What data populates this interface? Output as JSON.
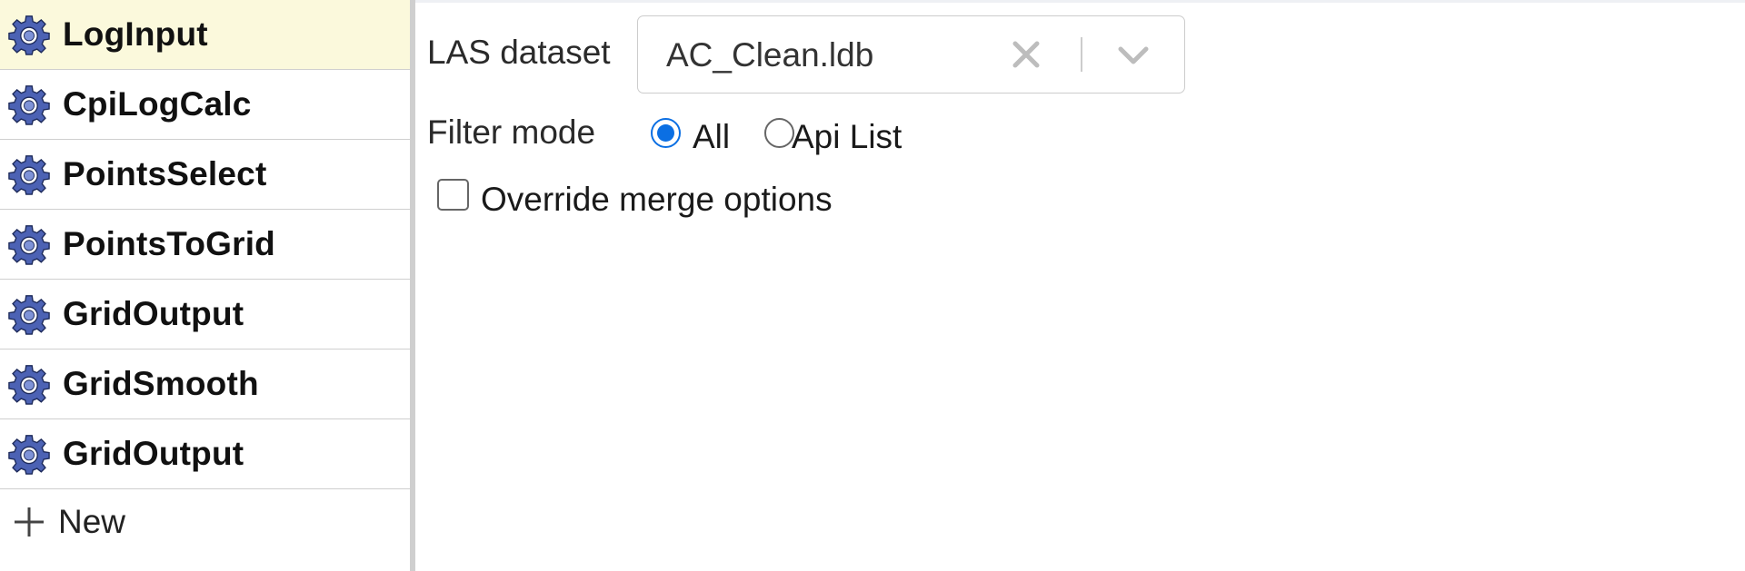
{
  "sidebar": {
    "items": [
      {
        "label": "LogInput",
        "icon": "gear-icon",
        "selected": true
      },
      {
        "label": "CpiLogCalc",
        "icon": "gear-icon",
        "selected": false
      },
      {
        "label": "PointsSelect",
        "icon": "gear-icon",
        "selected": false
      },
      {
        "label": "PointsToGrid",
        "icon": "gear-icon",
        "selected": false
      },
      {
        "label": "GridOutput",
        "icon": "gear-icon",
        "selected": false
      },
      {
        "label": "GridSmooth",
        "icon": "gear-icon",
        "selected": false
      },
      {
        "label": "GridOutput",
        "icon": "gear-icon",
        "selected": false
      }
    ],
    "new_label": "New",
    "new_icon": "plus-icon"
  },
  "form": {
    "dataset_label": "LAS dataset",
    "dataset_value": "AC_Clean.ldb",
    "filter_mode_label": "Filter mode",
    "filter_options": [
      {
        "label": "All",
        "checked": true
      },
      {
        "label": "Api List",
        "checked": false
      }
    ],
    "override_label": "Override merge options",
    "override_checked": false
  },
  "colors": {
    "selected_row_bg": "#fbf9dc",
    "accent": "#0b6fe3",
    "gear_fill": "#4c62b4"
  }
}
